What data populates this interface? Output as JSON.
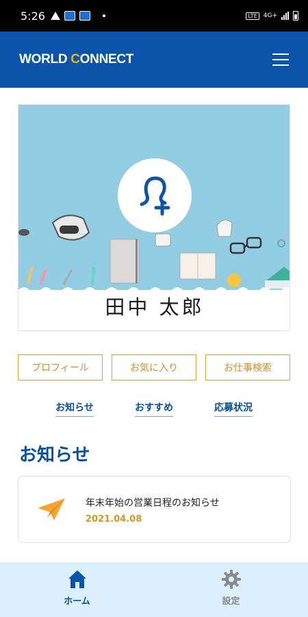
{
  "status_bar": {
    "time": "5:26",
    "network": "4G+"
  },
  "header": {
    "logo_part1": "WORLD ",
    "logo_c": "C",
    "logo_part2": "ONNECT",
    "menu_icon": "hamburger-menu-icon"
  },
  "profile": {
    "name": "田中 太郎",
    "avatar_icon": "add-user-icon"
  },
  "actions": [
    {
      "label": "プロフィール"
    },
    {
      "label": "お気に入り"
    },
    {
      "label": "お仕事検索"
    }
  ],
  "sub_tabs": [
    {
      "label": "お知らせ"
    },
    {
      "label": "おすすめ"
    },
    {
      "label": "応募状況"
    }
  ],
  "news_section": {
    "title": "お知らせ",
    "items": [
      {
        "title": "年末年始の営業日程のお知らせ",
        "date": "2021.04.08",
        "icon": "paper-plane-icon"
      }
    ]
  },
  "bottom_nav": {
    "home_label": "ホーム",
    "settings_label": "設定"
  },
  "colors": {
    "brand_blue": "#0a54aa",
    "accent_gold": "#d9a13a",
    "hero_bg": "#93cde3",
    "nav_bg": "#dcefff"
  }
}
